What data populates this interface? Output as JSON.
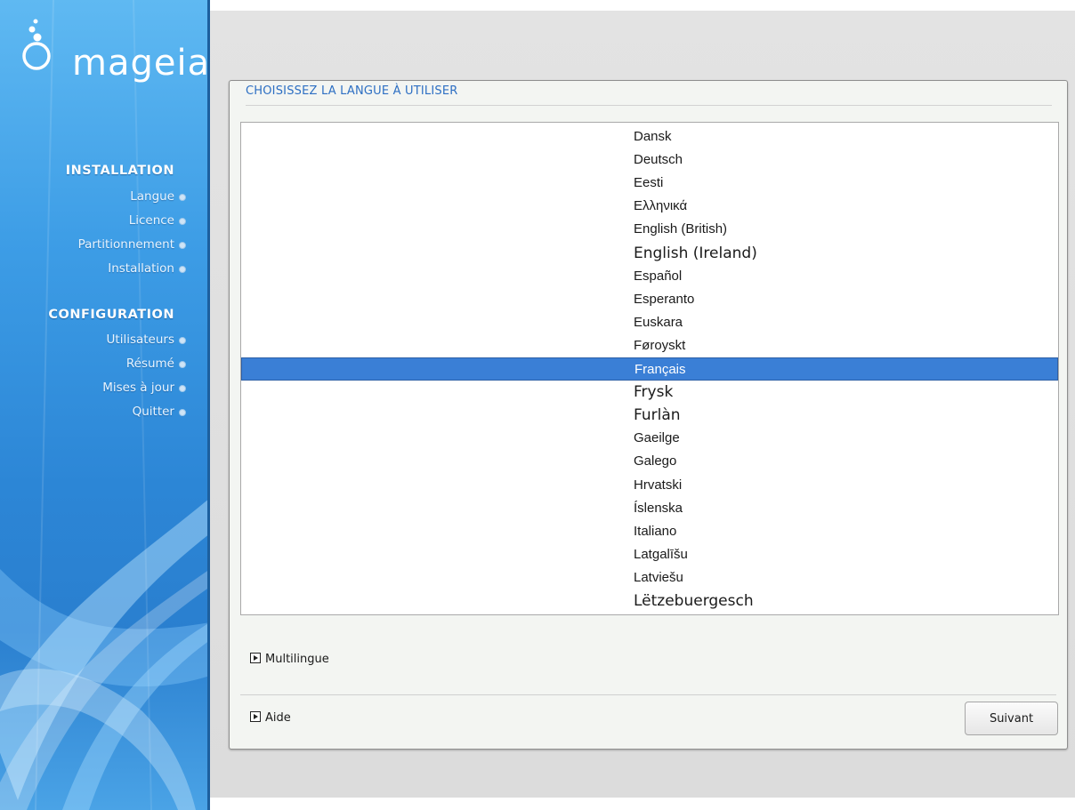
{
  "colors": {
    "sidebar_blue": "#2c86d6",
    "title_blue": "#2d6fc3",
    "selection_blue": "#3a7fd6",
    "panel_background": "#f3f5f2"
  },
  "sidebar": {
    "logo_text": "mageia",
    "sections": [
      {
        "title": "INSTALLATION",
        "items": [
          "Langue",
          "Licence",
          "Partitionnement",
          "Installation"
        ]
      },
      {
        "title": "CONFIGURATION",
        "items": [
          "Utilisateurs",
          "Résumé",
          "Mises à jour",
          "Quitter"
        ]
      }
    ]
  },
  "panel": {
    "title": "CHOISISSEZ LA LANGUE À UTILISER",
    "languages": [
      "Dansk",
      "Deutsch",
      "Eesti",
      "Ελληνικά",
      "English (British)",
      "English (Ireland)",
      "Español",
      "Esperanto",
      "Euskara",
      "Føroyskt",
      "Français",
      "Frysk",
      "Furlàn",
      "Gaeilge",
      "Galego",
      "Hrvatski",
      "Íslenska",
      "Italiano",
      "Latgalīšu",
      "Latviešu",
      "Lëtzebuergesch"
    ],
    "selected_language": "Français",
    "multilingual_label": "Multilingue",
    "help_label": "Aide",
    "next_label": "Suivant"
  }
}
